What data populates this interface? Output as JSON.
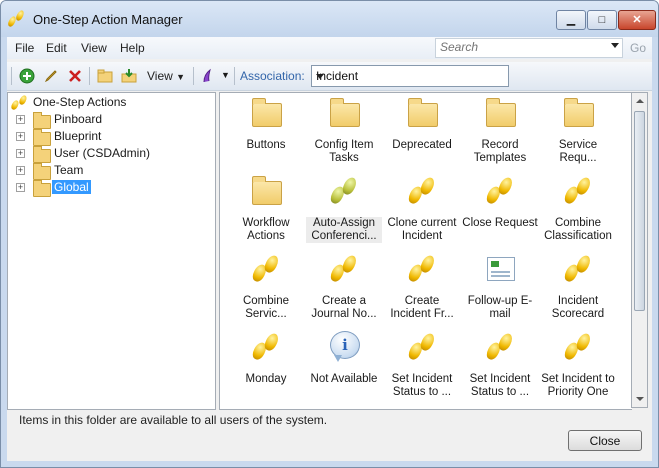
{
  "window": {
    "title": "One-Step Action Manager",
    "title_icon": "footprints-icon"
  },
  "menu": [
    "File",
    "Edit",
    "View",
    "Help"
  ],
  "search": {
    "placeholder": "Search",
    "go_label": "Go"
  },
  "toolbar": {
    "view_label": "View",
    "association_label": "Association:",
    "association_value": "Incident",
    "icons": [
      "add-icon",
      "edit-icon",
      "delete-icon",
      "folder-icon",
      "import-icon",
      "dropdown-icon",
      "bookmark-icon",
      "dropdown-icon"
    ]
  },
  "tree": {
    "root": "One-Step Actions",
    "children": [
      "Pinboard",
      "Blueprint",
      "User (CSDAdmin)",
      "Team",
      "Global"
    ],
    "selected": "Global"
  },
  "items": [
    {
      "label": "Buttons",
      "icon": "folder"
    },
    {
      "label": "Config Item Tasks",
      "icon": "folder"
    },
    {
      "label": "Deprecated",
      "icon": "folder"
    },
    {
      "label": "Record Templates",
      "icon": "folder"
    },
    {
      "label": "Service Requ...",
      "icon": "folder"
    },
    {
      "label": "Workflow Actions",
      "icon": "folder"
    },
    {
      "label": "Auto-Assign Conferenci...",
      "icon": "footprints-gray"
    },
    {
      "label": "Clone current Incident",
      "icon": "footprints"
    },
    {
      "label": "Close Request",
      "icon": "footprints"
    },
    {
      "label": "Combine Classification",
      "icon": "footprints"
    },
    {
      "label": "Combine Servic...",
      "icon": "footprints"
    },
    {
      "label": "Create a Journal No...",
      "icon": "footprints"
    },
    {
      "label": "Create Incident Fr...",
      "icon": "footprints"
    },
    {
      "label": "Follow-up E-mail",
      "icon": "email"
    },
    {
      "label": "Incident Scorecard",
      "icon": "footprints"
    },
    {
      "label": "Monday",
      "icon": "footprints"
    },
    {
      "label": "Not Available",
      "icon": "info"
    },
    {
      "label": "Set Incident Status to ...",
      "icon": "footprints"
    },
    {
      "label": "Set Incident Status to ...",
      "icon": "footprints"
    },
    {
      "label": "Set Incident to Priority One",
      "icon": "footprints"
    }
  ],
  "status_text": "Items in this folder are available to all users of the system.",
  "close_label": "Close",
  "colors": {
    "selection": "#3399ff",
    "association_label": "#3366aa",
    "footprint": "#f0b800"
  }
}
